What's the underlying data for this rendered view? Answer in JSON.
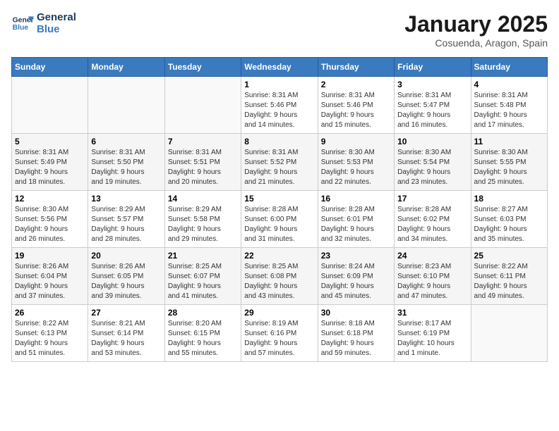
{
  "header": {
    "logo_line1": "General",
    "logo_line2": "Blue",
    "title": "January 2025",
    "subtitle": "Cosuenda, Aragon, Spain"
  },
  "weekdays": [
    "Sunday",
    "Monday",
    "Tuesday",
    "Wednesday",
    "Thursday",
    "Friday",
    "Saturday"
  ],
  "weeks": [
    [
      {
        "day": "",
        "info": ""
      },
      {
        "day": "",
        "info": ""
      },
      {
        "day": "",
        "info": ""
      },
      {
        "day": "1",
        "info": "Sunrise: 8:31 AM\nSunset: 5:46 PM\nDaylight: 9 hours\nand 14 minutes."
      },
      {
        "day": "2",
        "info": "Sunrise: 8:31 AM\nSunset: 5:46 PM\nDaylight: 9 hours\nand 15 minutes."
      },
      {
        "day": "3",
        "info": "Sunrise: 8:31 AM\nSunset: 5:47 PM\nDaylight: 9 hours\nand 16 minutes."
      },
      {
        "day": "4",
        "info": "Sunrise: 8:31 AM\nSunset: 5:48 PM\nDaylight: 9 hours\nand 17 minutes."
      }
    ],
    [
      {
        "day": "5",
        "info": "Sunrise: 8:31 AM\nSunset: 5:49 PM\nDaylight: 9 hours\nand 18 minutes."
      },
      {
        "day": "6",
        "info": "Sunrise: 8:31 AM\nSunset: 5:50 PM\nDaylight: 9 hours\nand 19 minutes."
      },
      {
        "day": "7",
        "info": "Sunrise: 8:31 AM\nSunset: 5:51 PM\nDaylight: 9 hours\nand 20 minutes."
      },
      {
        "day": "8",
        "info": "Sunrise: 8:31 AM\nSunset: 5:52 PM\nDaylight: 9 hours\nand 21 minutes."
      },
      {
        "day": "9",
        "info": "Sunrise: 8:30 AM\nSunset: 5:53 PM\nDaylight: 9 hours\nand 22 minutes."
      },
      {
        "day": "10",
        "info": "Sunrise: 8:30 AM\nSunset: 5:54 PM\nDaylight: 9 hours\nand 23 minutes."
      },
      {
        "day": "11",
        "info": "Sunrise: 8:30 AM\nSunset: 5:55 PM\nDaylight: 9 hours\nand 25 minutes."
      }
    ],
    [
      {
        "day": "12",
        "info": "Sunrise: 8:30 AM\nSunset: 5:56 PM\nDaylight: 9 hours\nand 26 minutes."
      },
      {
        "day": "13",
        "info": "Sunrise: 8:29 AM\nSunset: 5:57 PM\nDaylight: 9 hours\nand 28 minutes."
      },
      {
        "day": "14",
        "info": "Sunrise: 8:29 AM\nSunset: 5:58 PM\nDaylight: 9 hours\nand 29 minutes."
      },
      {
        "day": "15",
        "info": "Sunrise: 8:28 AM\nSunset: 6:00 PM\nDaylight: 9 hours\nand 31 minutes."
      },
      {
        "day": "16",
        "info": "Sunrise: 8:28 AM\nSunset: 6:01 PM\nDaylight: 9 hours\nand 32 minutes."
      },
      {
        "day": "17",
        "info": "Sunrise: 8:28 AM\nSunset: 6:02 PM\nDaylight: 9 hours\nand 34 minutes."
      },
      {
        "day": "18",
        "info": "Sunrise: 8:27 AM\nSunset: 6:03 PM\nDaylight: 9 hours\nand 35 minutes."
      }
    ],
    [
      {
        "day": "19",
        "info": "Sunrise: 8:26 AM\nSunset: 6:04 PM\nDaylight: 9 hours\nand 37 minutes."
      },
      {
        "day": "20",
        "info": "Sunrise: 8:26 AM\nSunset: 6:05 PM\nDaylight: 9 hours\nand 39 minutes."
      },
      {
        "day": "21",
        "info": "Sunrise: 8:25 AM\nSunset: 6:07 PM\nDaylight: 9 hours\nand 41 minutes."
      },
      {
        "day": "22",
        "info": "Sunrise: 8:25 AM\nSunset: 6:08 PM\nDaylight: 9 hours\nand 43 minutes."
      },
      {
        "day": "23",
        "info": "Sunrise: 8:24 AM\nSunset: 6:09 PM\nDaylight: 9 hours\nand 45 minutes."
      },
      {
        "day": "24",
        "info": "Sunrise: 8:23 AM\nSunset: 6:10 PM\nDaylight: 9 hours\nand 47 minutes."
      },
      {
        "day": "25",
        "info": "Sunrise: 8:22 AM\nSunset: 6:11 PM\nDaylight: 9 hours\nand 49 minutes."
      }
    ],
    [
      {
        "day": "26",
        "info": "Sunrise: 8:22 AM\nSunset: 6:13 PM\nDaylight: 9 hours\nand 51 minutes."
      },
      {
        "day": "27",
        "info": "Sunrise: 8:21 AM\nSunset: 6:14 PM\nDaylight: 9 hours\nand 53 minutes."
      },
      {
        "day": "28",
        "info": "Sunrise: 8:20 AM\nSunset: 6:15 PM\nDaylight: 9 hours\nand 55 minutes."
      },
      {
        "day": "29",
        "info": "Sunrise: 8:19 AM\nSunset: 6:16 PM\nDaylight: 9 hours\nand 57 minutes."
      },
      {
        "day": "30",
        "info": "Sunrise: 8:18 AM\nSunset: 6:18 PM\nDaylight: 9 hours\nand 59 minutes."
      },
      {
        "day": "31",
        "info": "Sunrise: 8:17 AM\nSunset: 6:19 PM\nDaylight: 10 hours\nand 1 minute."
      },
      {
        "day": "",
        "info": ""
      }
    ]
  ]
}
